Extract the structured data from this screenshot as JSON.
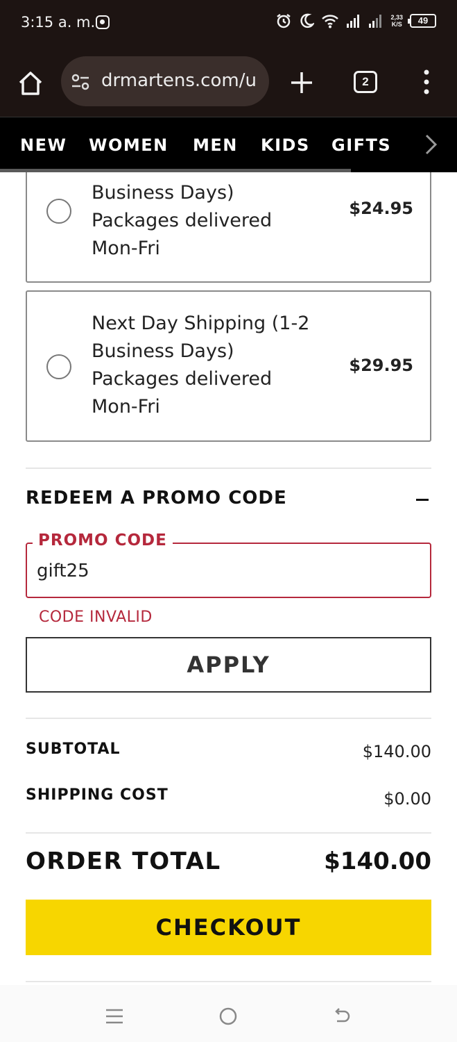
{
  "status_bar": {
    "time": "3:15 a. m.",
    "net_speed_value": "2,33",
    "net_speed_unit": "K/S",
    "battery": "49"
  },
  "browser": {
    "url": "drmartens.com/u",
    "tab_count": "2"
  },
  "site_nav": {
    "items": [
      "NEW",
      "WOMEN",
      "MEN",
      "KIDS",
      "GIFTS"
    ]
  },
  "shipping": {
    "options": [
      {
        "line1": "Business Days)",
        "line2": "Packages delivered",
        "line3": "Mon-Fri",
        "price": "$24.95",
        "selected": false
      },
      {
        "line0": "Next Day Shipping (1-2",
        "line1": "Business Days)",
        "line2": "Packages delivered",
        "line3": "Mon-Fri",
        "price": "$29.95",
        "selected": false
      }
    ]
  },
  "promo": {
    "heading": "REDEEM A PROMO CODE",
    "field_label": "PROMO CODE",
    "value": "gift25",
    "error": "CODE INVALID",
    "apply_label": "APPLY"
  },
  "summary": {
    "subtotal_label": "SUBTOTAL",
    "subtotal_value": "$140.00",
    "shipping_label": "SHIPPING COST",
    "shipping_value": "$0.00",
    "total_label": "ORDER TOTAL",
    "total_value": "$140.00",
    "checkout_label": "CHECKOUT"
  },
  "colors": {
    "error_red": "#b5283c",
    "checkout_yellow": "#f7d600",
    "browser_dark": "#1d1412"
  }
}
